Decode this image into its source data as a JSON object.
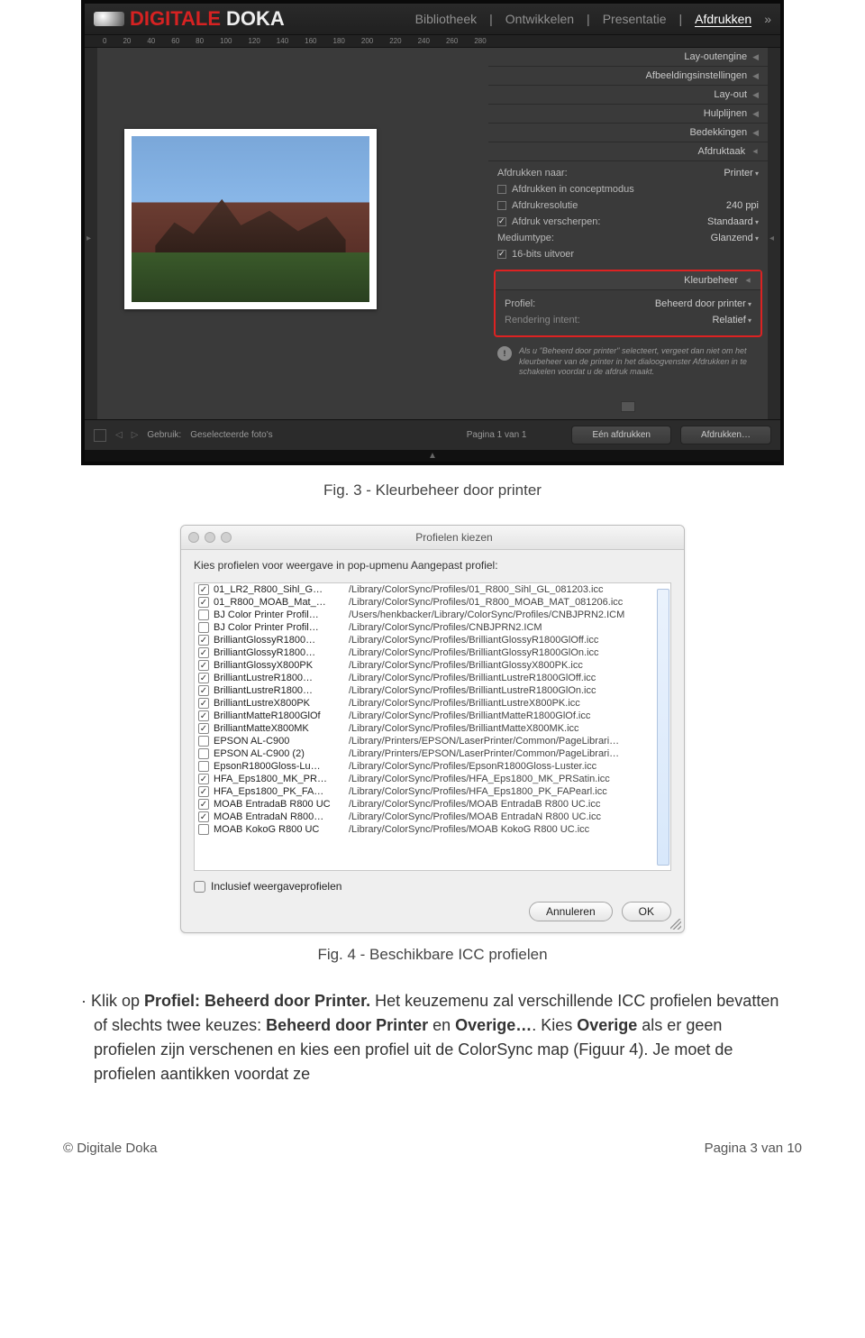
{
  "lr": {
    "logo_red": "DIGITALE",
    "logo_white": "DOKA",
    "menu": {
      "bibliotheek": "Bibliotheek",
      "ontwikkelen": "Ontwikkelen",
      "presentatie": "Presentatie",
      "afdrukken": "Afdrukken"
    },
    "ruler": [
      "0",
      "20",
      "40",
      "60",
      "80",
      "100",
      "120",
      "140",
      "160",
      "180",
      "200",
      "220",
      "240",
      "260",
      "280"
    ],
    "panels": {
      "layoutengine": "Lay-outengine",
      "afbeeldings": "Afbeeldingsinstellingen",
      "layout": "Lay-out",
      "hulplijnen": "Hulplijnen",
      "bedekkingen": "Bedekkingen",
      "afdruktaak": "Afdruktaak"
    },
    "task": {
      "afdrukken_naar_label": "Afdrukken naar:",
      "afdrukken_naar_value": "Printer",
      "concept": "Afdrukken in conceptmodus",
      "resolutie_label": "Afdrukresolutie",
      "resolutie_value": "240 ppi",
      "verscherpen_label": "Afdruk verscherpen:",
      "verscherpen_value": "Standaard",
      "medium_label": "Mediumtype:",
      "medium_value": "Glanzend",
      "bits": "16-bits uitvoer"
    },
    "kleur": {
      "head": "Kleurbeheer",
      "profiel_label": "Profiel:",
      "profiel_value": "Beheerd door printer",
      "intent_label": "Rendering intent:",
      "intent_value": "Relatief",
      "info": "Als u \"Beheerd door printer\" selecteert, vergeet dan niet om het kleurbeheer van de printer in het dialoogvenster Afdrukken in te schakelen voordat u de afdruk maakt."
    },
    "bottom": {
      "gebruik_label": "Gebruik:",
      "gebruik_value": "Geselecteerde foto's",
      "pagina": "Pagina 1 van 1",
      "btn1": "Eén afdrukken",
      "btn2": "Afdrukken…"
    }
  },
  "mac": {
    "title": "Profielen kiezen",
    "subtitle": "Kies profielen voor weergave in pop-upmenu Aangepast profiel:",
    "rows": [
      {
        "c": true,
        "n": "01_LR2_R800_Sihl_G…",
        "p": "/Library/ColorSync/Profiles/01_R800_Sihl_GL_081203.icc"
      },
      {
        "c": true,
        "n": "01_R800_MOAB_Mat_…",
        "p": "/Library/ColorSync/Profiles/01_R800_MOAB_MAT_081206.icc"
      },
      {
        "c": false,
        "n": "BJ Color Printer Profil…",
        "p": "/Users/henkbacker/Library/ColorSync/Profiles/CNBJPRN2.ICM"
      },
      {
        "c": false,
        "n": "BJ Color Printer Profil…",
        "p": "/Library/ColorSync/Profiles/CNBJPRN2.ICM"
      },
      {
        "c": true,
        "n": "BrilliantGlossyR1800…",
        "p": "/Library/ColorSync/Profiles/BrilliantGlossyR1800GlOff.icc"
      },
      {
        "c": true,
        "n": "BrilliantGlossyR1800…",
        "p": "/Library/ColorSync/Profiles/BrilliantGlossyR1800GlOn.icc"
      },
      {
        "c": true,
        "n": "BrilliantGlossyX800PK",
        "p": "/Library/ColorSync/Profiles/BrilliantGlossyX800PK.icc"
      },
      {
        "c": true,
        "n": "BrilliantLustreR1800…",
        "p": "/Library/ColorSync/Profiles/BrilliantLustreR1800GlOff.icc"
      },
      {
        "c": true,
        "n": "BrilliantLustreR1800…",
        "p": "/Library/ColorSync/Profiles/BrilliantLustreR1800GlOn.icc"
      },
      {
        "c": true,
        "n": "BrilliantLustreX800PK",
        "p": "/Library/ColorSync/Profiles/BrilliantLustreX800PK.icc"
      },
      {
        "c": true,
        "n": "BrilliantMatteR1800GlOf",
        "p": "/Library/ColorSync/Profiles/BrilliantMatteR1800GlOf.icc"
      },
      {
        "c": true,
        "n": "BrilliantMatteX800MK",
        "p": "/Library/ColorSync/Profiles/BrilliantMatteX800MK.icc"
      },
      {
        "c": false,
        "n": "EPSON AL-C900",
        "p": "/Library/Printers/EPSON/LaserPrinter/Common/PageLibrari…"
      },
      {
        "c": false,
        "n": "EPSON AL-C900 (2)",
        "p": "/Library/Printers/EPSON/LaserPrinter/Common/PageLibrari…"
      },
      {
        "c": false,
        "n": "EpsonR1800Gloss-Lu…",
        "p": "/Library/ColorSync/Profiles/EpsonR1800Gloss-Luster.icc"
      },
      {
        "c": true,
        "n": "HFA_Eps1800_MK_PR…",
        "p": "/Library/ColorSync/Profiles/HFA_Eps1800_MK_PRSatin.icc"
      },
      {
        "c": true,
        "n": "HFA_Eps1800_PK_FA…",
        "p": "/Library/ColorSync/Profiles/HFA_Eps1800_PK_FAPearl.icc"
      },
      {
        "c": true,
        "n": "MOAB EntradaB R800 UC",
        "p": "/Library/ColorSync/Profiles/MOAB EntradaB R800 UC.icc"
      },
      {
        "c": true,
        "n": "MOAB EntradaN R800…",
        "p": "/Library/ColorSync/Profiles/MOAB EntradaN R800 UC.icc"
      },
      {
        "c": false,
        "n": "MOAB KokoG R800 UC",
        "p": "/Library/ColorSync/Profiles/MOAB KokoG R800 UC.icc"
      }
    ],
    "inclusief": "Inclusief weergaveprofielen",
    "cancel": "Annuleren",
    "ok": "OK"
  },
  "captions": {
    "fig3": "Fig. 3 - Kleurbeheer door printer",
    "fig4": "Fig. 4 - Beschikbare ICC profielen"
  },
  "body": {
    "p1a": "Klik op ",
    "p1b": "Profiel: Beheerd door Printer.",
    "p1c": " Het keuzemenu zal verschillende ICC profielen bevatten of slechts twee keuzes: ",
    "p1d": "Beheerd door Printer",
    "p1e": " en ",
    "p1f": "Overige…",
    "p1g": ". Kies ",
    "p1h": "Overige",
    "p1i": " als er geen profielen zijn verschenen en kies een profiel uit de ColorSync map (Figuur 4). Je moet de profielen aantikken voordat ze"
  },
  "footer": {
    "left": "© Digitale Doka",
    "right": "Pagina 3 van 10"
  }
}
